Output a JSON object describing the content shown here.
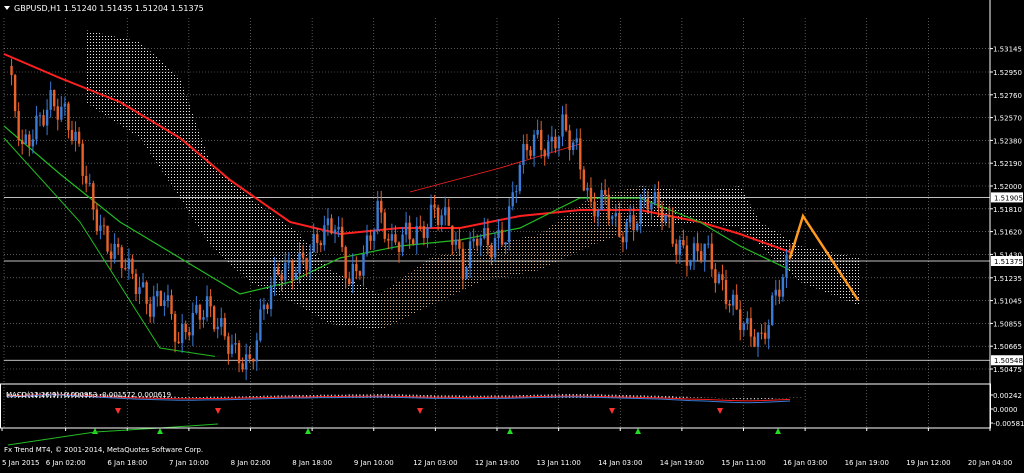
{
  "header": {
    "symbol_line": "GBPUSD,H1  1.51240 1.51435 1.51204 1.51375"
  },
  "indicator_header": "MACD(12,26,9) -0.000953 -0.001572 0.000619",
  "watermark": "Fx Trend MT4, © 2001-2014, MetaQuotes Software Corp.",
  "colors": {
    "background": "#000000",
    "grid": "#ffffff",
    "bull_candle": "#3a7bd5",
    "bear_candle": "#e8622a",
    "ma_red": "#ff2020",
    "ma_green": "#22bb22",
    "cloud_white": "#e8e8e8",
    "cloud_tan": "#d9b38c",
    "projection": "#ff9a1f",
    "price_tag_bg": "#ffffff",
    "price_tag_text": "#000000"
  },
  "chart_data": [
    {
      "type": "candlestick",
      "symbol": "GBPUSD",
      "timeframe": "H1",
      "ylim": [
        1.5045,
        1.534
      ],
      "y_ticks": [
        "1.53145",
        "1.52950",
        "1.52760",
        "1.52570",
        "1.52380",
        "1.52190",
        "1.52000",
        "1.51810",
        "1.51620",
        "1.51430",
        "1.51235",
        "1.51045",
        "1.50855",
        "1.50665",
        "1.50475"
      ],
      "x_ticks": [
        "5 Jan 2015",
        "6 Jan 02:00",
        "6 Jan 18:00",
        "7 Jan 10:00",
        "8 Jan 02:00",
        "8 Jan 18:00",
        "9 Jan 10:00",
        "12 Jan 03:00",
        "12 Jan 19:00",
        "13 Jan 11:00",
        "14 Jan 03:00",
        "14 Jan 19:00",
        "15 Jan 11:00",
        "16 Jan 03:00",
        "16 Jan 19:00",
        "19 Jan 12:00",
        "20 Jan 04:00"
      ],
      "horizontal_lines": [
        {
          "value": 1.51905,
          "label": "1.51905"
        },
        {
          "value": 1.51375,
          "label": "1.51375"
        },
        {
          "value": 1.50548,
          "label": "1.50548"
        }
      ],
      "current_price_label": "1.51375",
      "close_path": [
        1.53,
        1.523,
        1.525,
        1.527,
        1.526,
        1.523,
        1.518,
        1.515,
        1.514,
        1.512,
        1.51,
        1.511,
        1.507,
        1.509,
        1.51,
        1.508,
        1.506,
        1.505,
        1.51,
        1.513,
        1.513,
        1.514,
        1.516,
        1.517,
        1.512,
        1.514,
        1.518,
        1.515,
        1.516,
        1.516,
        1.518,
        1.517,
        1.513,
        1.516,
        1.515,
        1.516,
        1.522,
        1.524,
        1.523,
        1.525,
        1.523,
        1.518,
        1.519,
        1.516,
        1.517,
        1.519,
        1.518,
        1.515,
        1.514,
        1.515,
        1.512,
        1.51,
        1.508,
        1.507,
        1.511,
        1.514
      ],
      "projection": [
        1.514,
        1.5175,
        1.5105
      ],
      "projection_start": 56
    },
    {
      "type": "histogram",
      "name": "MACD(12,26,9)",
      "ylim": [
        -0.0009,
        0.0003
      ],
      "y_ticks": [
        "0.00242",
        "0.0000",
        "-0.00581"
      ],
      "values": [
        0.00012,
        0.00014,
        0.00016,
        0.00018,
        0.00017,
        0.00015,
        0.00012,
        0.0001,
        8e-05,
        6e-05,
        5e-05,
        4e-05,
        3e-05,
        3e-05,
        4e-05,
        4e-05,
        5e-05,
        6e-05,
        7e-05,
        8e-05,
        9e-05,
        9e-05,
        0.0001,
        0.0001,
        0.00011,
        0.00011,
        0.00012,
        0.00011,
        0.0001,
        9e-05,
        8e-05,
        8e-05,
        7e-05,
        7e-05,
        8e-05,
        8e-05,
        9e-05,
        0.0001,
        0.00011,
        0.00012,
        0.00012,
        0.00011,
        0.0001,
        9e-05,
        8e-05,
        7e-05,
        6e-05,
        4e-05,
        2e-05,
        1e-05,
        -1e-05,
        -3e-05,
        -4e-05,
        -3e-05,
        -1e-05,
        1e-05
      ]
    }
  ]
}
